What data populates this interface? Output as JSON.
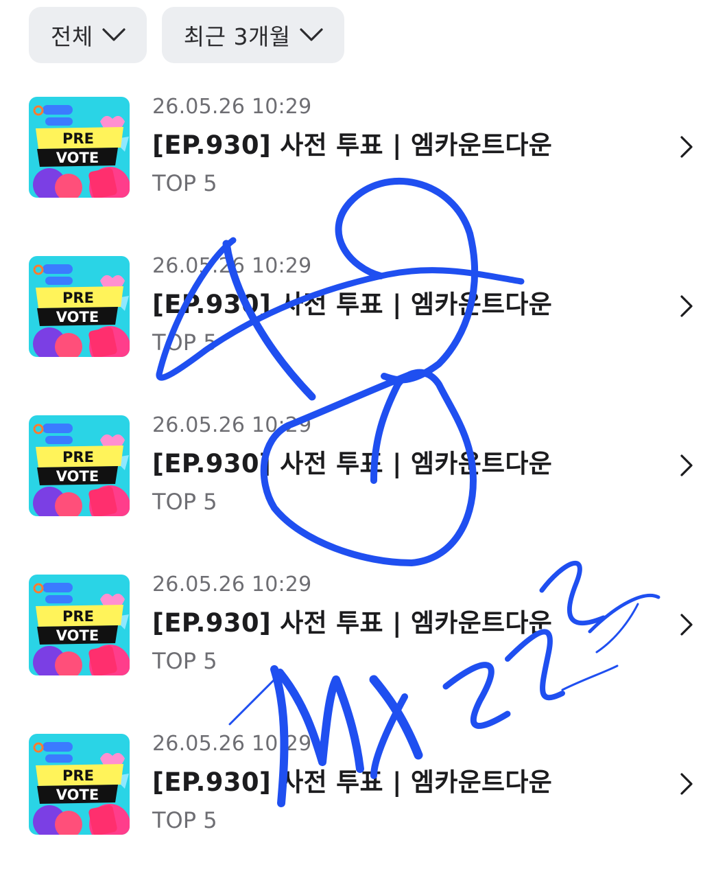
{
  "filters": {
    "category": {
      "label": "전체",
      "icon": "chevron-down-icon"
    },
    "period": {
      "label": "최근 3개월",
      "icon": "chevron-down-icon"
    }
  },
  "items": [
    {
      "date": "26.05.26 10:29",
      "title": "[EP.930] 사전 투표 | 엠카운트다운",
      "sub": "TOP 5",
      "thumb_badge": [
        "PRE",
        "VOTE"
      ]
    },
    {
      "date": "26.05.26 10:29",
      "title": "[EP.930] 사전 투표 | 엠카운트다운",
      "sub": "TOP 5",
      "thumb_badge": [
        "PRE",
        "VOTE"
      ]
    },
    {
      "date": "26.05.26 10:29",
      "title": "[EP.930] 사전 투표 | 엠카운트다운",
      "sub": "TOP 5",
      "thumb_badge": [
        "PRE",
        "VOTE"
      ]
    },
    {
      "date": "26.05.26 10:29",
      "title": "[EP.930] 사전 투표 | 엠카운트다운",
      "sub": "TOP 5",
      "thumb_badge": [
        "PRE",
        "VOTE"
      ]
    },
    {
      "date": "26.05.26 10:29",
      "title": "[EP.930] 사전 투표 | 엠카운트다운",
      "sub": "TOP 5",
      "thumb_badge": [
        "PRE",
        "VOTE"
      ]
    }
  ],
  "colors": {
    "chip_bg": "#eceef1",
    "secondary_text": "#6e6e73",
    "primary_text": "#1c1c1e",
    "scribble_blue": "#1f4ff0",
    "thumb_bg": "#2ad4e6",
    "thumb_banner": "#fff35a"
  },
  "overlay": {
    "type": "handwritten-signature",
    "color": "#1f4ff0"
  }
}
